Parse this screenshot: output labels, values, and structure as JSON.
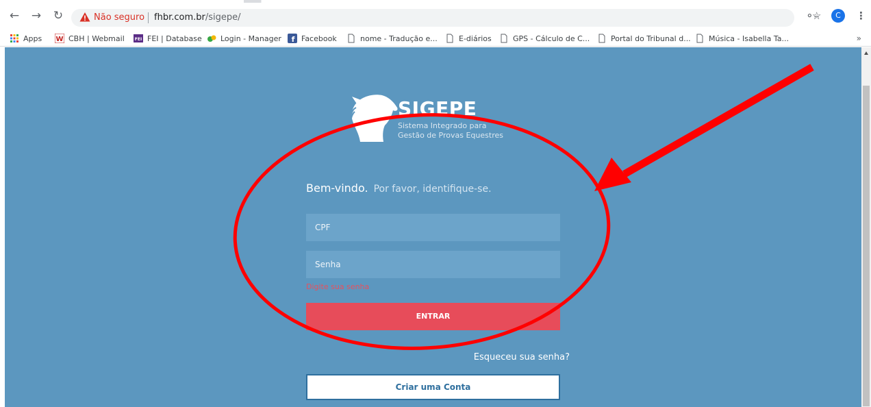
{
  "browser": {
    "security_label": "Não seguro",
    "url_host": "fhbr.com.br",
    "url_path": "/sigepe/",
    "profile_initial": "C",
    "more_bookmarks": "»"
  },
  "bookmarks": [
    {
      "label": "Apps",
      "icon": "apps-grid-icon"
    },
    {
      "label": "CBH | Webmail",
      "icon": "webmail-w-icon"
    },
    {
      "label": "FEI | Database",
      "icon": "fei-icon"
    },
    {
      "label": "Login - Manager",
      "icon": "manager-icon"
    },
    {
      "label": "Facebook",
      "icon": "facebook-icon"
    },
    {
      "label": "nome - Tradução e...",
      "icon": "page-icon"
    },
    {
      "label": "E-diários",
      "icon": "page-icon"
    },
    {
      "label": "GPS - Cálculo de C...",
      "icon": "page-icon"
    },
    {
      "label": "Portal do Tribunal d...",
      "icon": "page-icon"
    },
    {
      "label": "Música - Isabella Ta...",
      "icon": "page-icon"
    }
  ],
  "logo": {
    "title": "SIGEPE",
    "subtitle_line1": "Sistema Integrado para",
    "subtitle_line2": "Gestão de Provas Equestres"
  },
  "login": {
    "welcome": "Bem-vindo.",
    "welcome_sub": "Por favor, identifique-se.",
    "cpf_placeholder": "CPF",
    "senha_placeholder": "Senha",
    "error_text": "Digite sua senha",
    "submit_label": "ENTRAR",
    "forgot_label": "Esqueceu sua senha?",
    "create_account_label": "Criar uma Conta"
  },
  "colors": {
    "page_bg": "#5c97bf",
    "field_bg": "#6ca4ca",
    "submit_bg": "#e74c5a",
    "error": "#e8505d",
    "annotation": "#ff0000"
  }
}
